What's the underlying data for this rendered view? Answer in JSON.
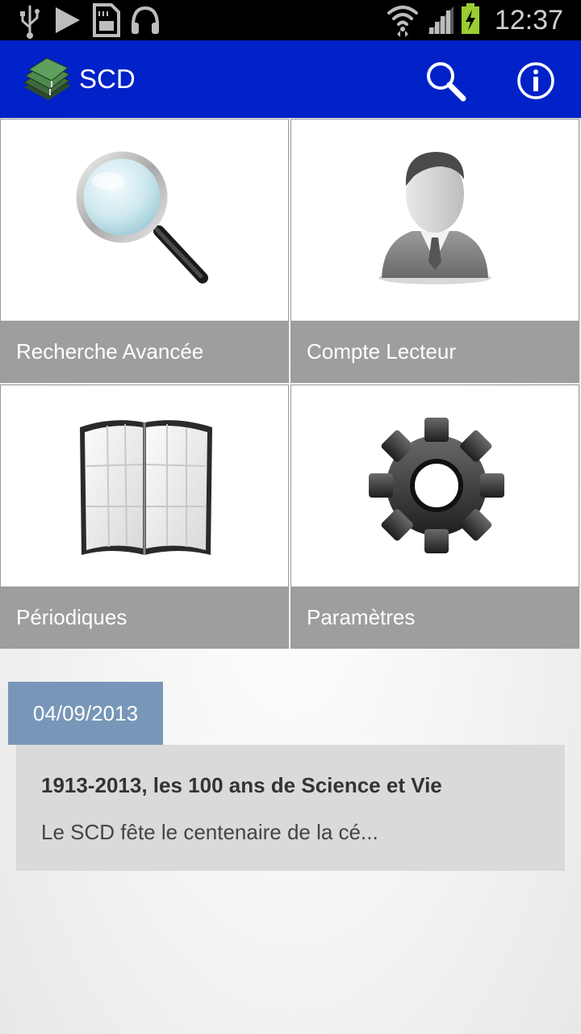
{
  "status_bar": {
    "time": "12:37",
    "icons": [
      "usb-icon",
      "play-icon",
      "sd-card-icon",
      "headphones-icon",
      "wifi-icon",
      "signal-icon",
      "battery-charging-icon"
    ]
  },
  "app_bar": {
    "title": "SCD",
    "logo": "books-logo",
    "actions": [
      "search-icon",
      "info-icon"
    ],
    "color": "#0022c8"
  },
  "tiles": [
    {
      "label": "Recherche Avancée",
      "icon": "magnifier-icon"
    },
    {
      "label": "Compte Lecteur",
      "icon": "user-icon"
    },
    {
      "label": "Périodiques",
      "icon": "periodicals-icon"
    },
    {
      "label": "Paramètres",
      "icon": "gear-icon"
    }
  ],
  "news": {
    "date": "04/09/2013",
    "title": "1913-2013, les 100 ans de Science et Vie",
    "excerpt": "Le SCD fête le centenaire de la cé..."
  },
  "colors": {
    "tile_label_bg": "#9e9e9e",
    "date_badge_bg": "#7897b8",
    "news_card_bg": "#dadada"
  }
}
